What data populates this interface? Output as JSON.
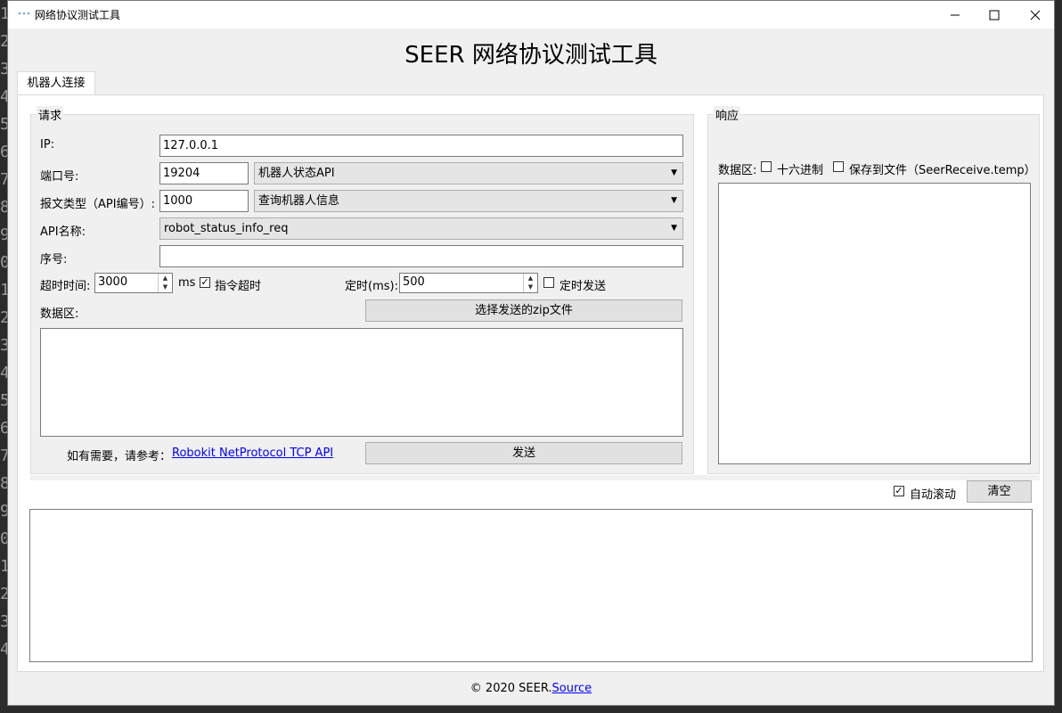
{
  "window": {
    "title": "网络协议测试工具"
  },
  "app_title": "SEER 网络协议测试工具",
  "tabs": [
    {
      "label": "机器人连接"
    }
  ],
  "request": {
    "group_title": "请求",
    "ip_label": "IP:",
    "ip_value": "127.0.0.1",
    "port_label": "端口号:",
    "port_value": "19204",
    "port_api_select": "机器人状态API",
    "msgtype_label": "报文类型（API编号）:",
    "msgtype_value": "1000",
    "msgtype_select": "查询机器人信息",
    "apiname_label": "API名称:",
    "apiname_select": "robot_status_info_req",
    "seq_label": "序号:",
    "seq_value": "",
    "timeout_label": "超时时间:",
    "timeout_value": "3000",
    "timeout_unit": "ms",
    "cmd_timeout_label": "指令超时",
    "cmd_timeout_checked": true,
    "timer_label": "定时(ms):",
    "timer_value": "500",
    "timer_send_label": "定时发送",
    "timer_send_checked": false,
    "data_label": "数据区:",
    "zip_button": "选择发送的zip文件",
    "ref_text": "如有需要，请参考：",
    "ref_link": "Robokit NetProtocol TCP API",
    "send_button": "发送"
  },
  "response": {
    "group_title": "响应",
    "data_label": "数据区:",
    "hex_label": "十六进制",
    "hex_checked": false,
    "save_label": "保存到文件（SeerReceive.temp）",
    "save_checked": false
  },
  "log": {
    "autoscroll_label": "自动滚动",
    "autoscroll_checked": true,
    "clear_button": "清空"
  },
  "footer": {
    "copyright": "© 2020 SEER.",
    "source_link": "Source"
  },
  "gutter_digits": [
    "1",
    "2",
    "3",
    "4",
    "5",
    "6",
    "7",
    "8",
    "9",
    "0",
    "1",
    "2",
    "3",
    "4",
    "5",
    "6",
    "7",
    "8",
    "9",
    "0",
    "1",
    "2",
    "3",
    "4"
  ],
  "colors": {
    "link": "#0000ff",
    "window_bg": "#f0f0f0",
    "backdrop": "#2b2b2b"
  }
}
